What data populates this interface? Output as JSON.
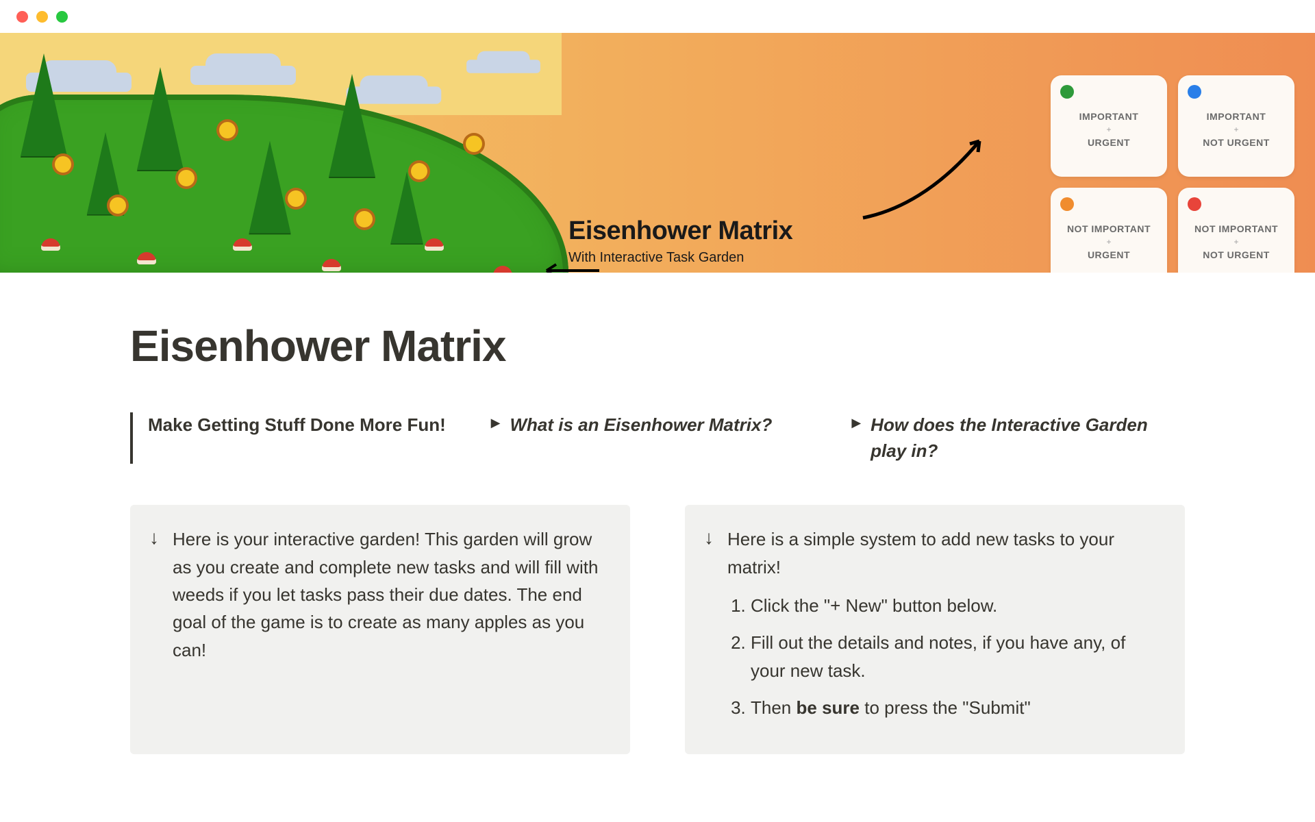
{
  "banner": {
    "title": "Eisenhower Matrix",
    "subtitle": "With Interactive Task Garden",
    "quadrants": [
      {
        "line1": "IMPORTANT",
        "line2": "URGENT",
        "dot": "#2e9a3a"
      },
      {
        "line1": "IMPORTANT",
        "line2": "NOT URGENT",
        "dot": "#2a7fe8"
      },
      {
        "line1": "NOT IMPORTANT",
        "line2": "URGENT",
        "dot": "#f08c2e"
      },
      {
        "line1": "NOT IMPORTANT",
        "line2": "NOT URGENT",
        "dot": "#e8443a"
      }
    ]
  },
  "page": {
    "title": "Eisenhower Matrix",
    "tagline": "Make Getting Stuff Done More Fun!",
    "toggle1": "What is an Eisenhower Matrix?",
    "toggle2": "How does the Interactive Garden play in?",
    "callout_left": "Here is your interactive garden! This garden will grow as you create and complete new tasks and will fill with weeds if you let tasks pass their due dates. The end goal of the game is to create as many apples as you can!",
    "callout_right_intro": "Here is a simple system to add new tasks to your matrix!",
    "steps": [
      "Click the \"+ New\" button below.",
      "Fill out the details and notes, if you have any, of your new task."
    ],
    "step3_prefix": "Then ",
    "step3_bold": "be sure",
    "step3_suffix": " to press the \"Submit\""
  }
}
